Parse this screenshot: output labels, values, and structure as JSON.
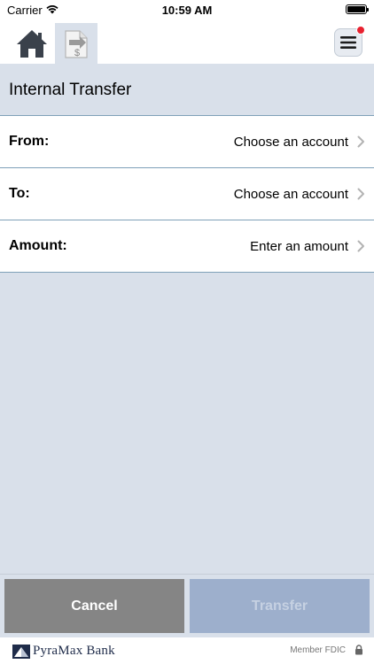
{
  "status_bar": {
    "carrier": "Carrier",
    "time": "10:59 AM"
  },
  "nav": {
    "home_icon": "home-icon",
    "transfer_icon": "transfer-dollar-icon",
    "menu_icon": "hamburger-menu-icon",
    "badge_color": "#e8212f"
  },
  "page": {
    "title": "Internal Transfer"
  },
  "form": {
    "rows": [
      {
        "label": "From:",
        "value": "Choose an account"
      },
      {
        "label": "To:",
        "value": "Choose an account"
      },
      {
        "label": "Amount:",
        "value": "Enter an amount"
      }
    ]
  },
  "actions": {
    "cancel_label": "Cancel",
    "transfer_label": "Transfer"
  },
  "footer": {
    "brand": "PyraMax Bank",
    "fdic": "Member FDIC"
  },
  "colors": {
    "background": "#d9e0ea",
    "divider": "#7fa1b8",
    "cancel": "#858585",
    "transfer_disabled": "#9dafcc"
  }
}
